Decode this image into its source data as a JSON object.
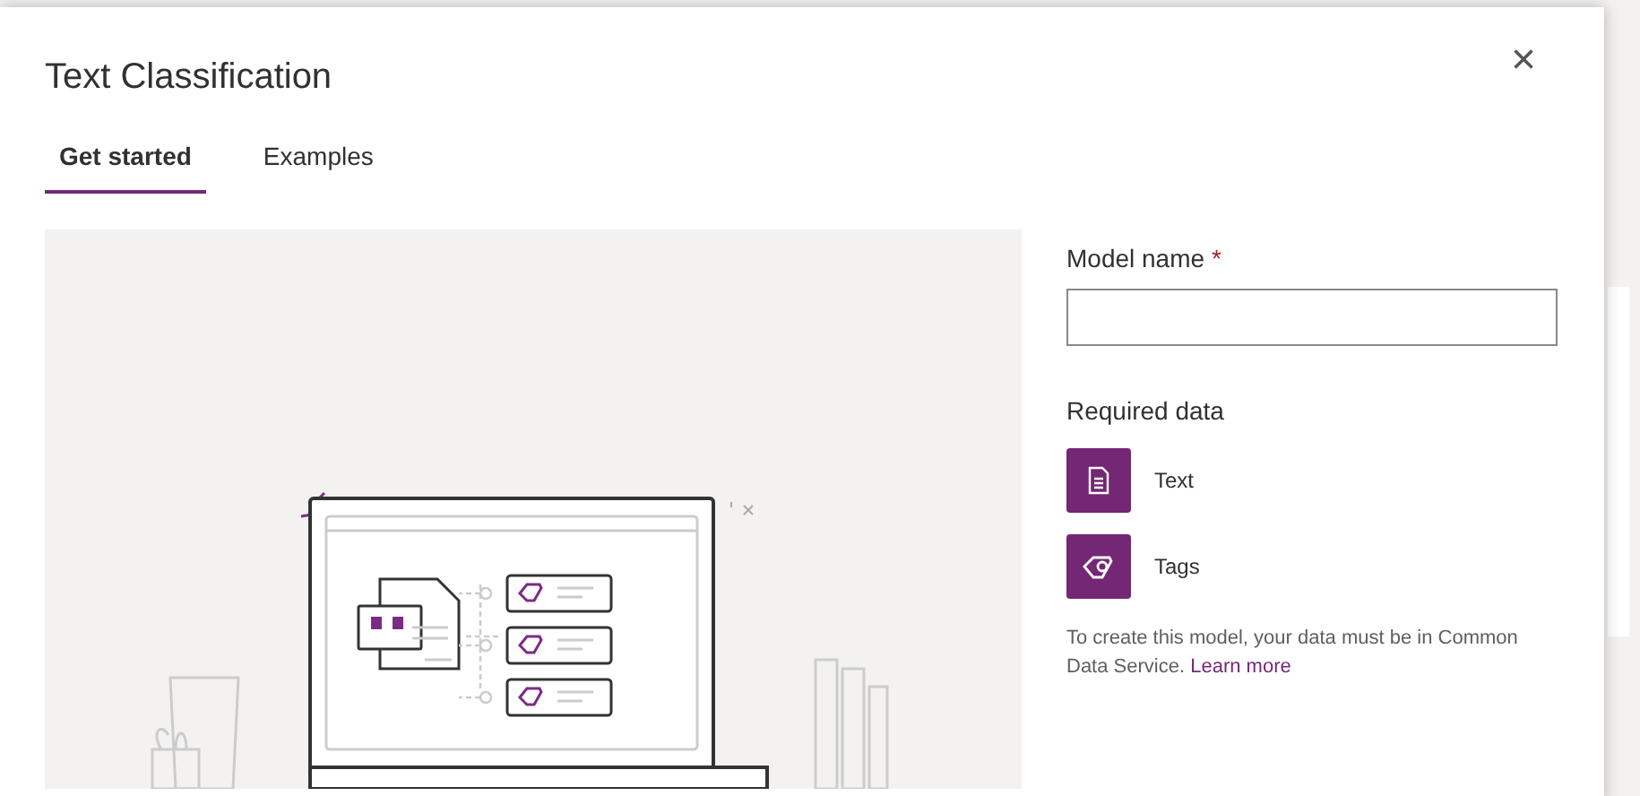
{
  "dialog": {
    "title": "Text Classification",
    "close": "×"
  },
  "tabs": [
    {
      "label": "Get started",
      "selected": true
    },
    {
      "label": "Examples",
      "selected": false
    }
  ],
  "form": {
    "model_name_label": "Model name",
    "required_mark": "*",
    "required_data_title": "Required data",
    "required_data": [
      {
        "kind": "text",
        "label": "Text"
      },
      {
        "kind": "tags",
        "label": "Tags"
      }
    ],
    "note": "To create this model, your data must be in Common Data Service.",
    "link": "Learn more"
  }
}
